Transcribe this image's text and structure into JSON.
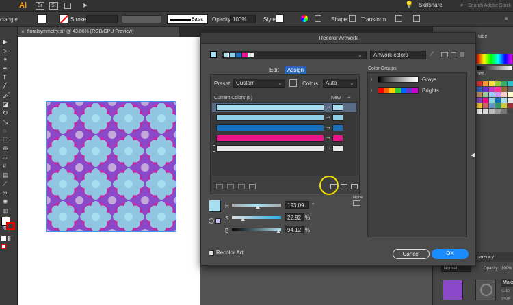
{
  "menubar": {
    "app_logo": "Ai",
    "app_color": "#ff9a00",
    "icons": [
      "Br",
      "St"
    ],
    "user": "Skillshare",
    "search_placeholder": "Search Adobe Stock"
  },
  "controlbar": {
    "tool_name": "ctangle",
    "stroke_label": "Stroke:",
    "brush_label": "Basic",
    "opacity_label": "Opacity:",
    "opacity_value": "100%",
    "style_label": "Style:",
    "shape_label": "Shape:",
    "transform_label": "Transform"
  },
  "document": {
    "tab_title": "floralsymmetry.ai* @ 43.86% (RGB/GPU Preview)"
  },
  "dialog": {
    "title": "Recolor Artwork",
    "group_name": "Artwork colors",
    "tabs": [
      "Edit",
      "Assign"
    ],
    "active_tab": "Assign",
    "preset_label": "Preset:",
    "preset_value": "Custom",
    "colors_label": "Colors:",
    "colors_value": "Auto",
    "current_colors_header": "Current Colors (5)",
    "new_header": "New",
    "rows": [
      {
        "color": "#a8dff0"
      },
      {
        "color": "#8ecfe6"
      },
      {
        "color": "#1a6fb8"
      },
      {
        "color": "#e8148a"
      },
      {
        "color": "#e8e8e8"
      }
    ],
    "color_groups_label": "Color Groups",
    "groups": [
      {
        "name": "Grays"
      },
      {
        "name": "Brights"
      }
    ],
    "none_label": "None",
    "sliders": [
      {
        "label": "H",
        "value": "193.09",
        "unit": "°",
        "pos": 0.54
      },
      {
        "label": "S",
        "value": "22.92",
        "unit": "%",
        "pos": 0.23
      },
      {
        "label": "B",
        "value": "94.12",
        "unit": "%",
        "pos": 0.94
      }
    ],
    "recolor_art_label": "Recolor Art",
    "cancel_label": "Cancel",
    "ok_label": "OK"
  },
  "right_panel": {
    "guide_label": "uide",
    "swatches_label": "hes",
    "transparency_label": "parency",
    "blend_mode": "Normal",
    "opacity_label": "Opacity:",
    "opacity_value": "100%",
    "make_label": "Make",
    "clip_label": "Clip",
    "invert_label": "Inve"
  }
}
